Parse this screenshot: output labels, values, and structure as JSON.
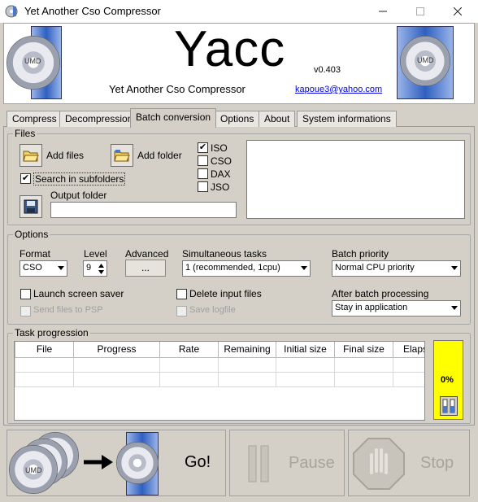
{
  "window": {
    "title": "Yet Another Cso Compressor"
  },
  "header": {
    "logo_text": "Yacc",
    "version": "v0.403",
    "subtitle": "Yet Another Cso Compressor",
    "email": "kapoue3@yahoo.com",
    "disc_label": "UMD"
  },
  "tabs": [
    {
      "label": "Compress"
    },
    {
      "label": "Decompression"
    },
    {
      "label": "Batch conversion",
      "active": true
    },
    {
      "label": "Options"
    },
    {
      "label": "About"
    },
    {
      "label": "System informations"
    }
  ],
  "files": {
    "group_label": "Files",
    "add_files_label": "Add files",
    "add_folder_label": "Add folder",
    "search_subfolders_label": "Search in subfolders",
    "search_subfolders_checked": true,
    "output_folder_label": "Output folder",
    "output_folder_value": "",
    "formats": [
      {
        "label": "ISO",
        "checked": true
      },
      {
        "label": "CSO",
        "checked": false
      },
      {
        "label": "DAX",
        "checked": false
      },
      {
        "label": "JSO",
        "checked": false
      }
    ]
  },
  "options": {
    "group_label": "Options",
    "format_label": "Format",
    "format_value": "CSO",
    "level_label": "Level",
    "level_value": "9",
    "advanced_label": "Advanced",
    "advanced_button": "...",
    "simultaneous_label": "Simultaneous tasks",
    "simultaneous_value": "1 (recommended, 1cpu)",
    "batch_priority_label": "Batch priority",
    "batch_priority_value": "Normal CPU priority",
    "launch_screensaver_label": "Launch screen saver",
    "delete_input_label": "Delete input files",
    "send_psp_label": "Send files to PSP",
    "save_logfile_label": "Save logfile",
    "after_batch_label": "After batch processing",
    "after_batch_value": "Stay in application"
  },
  "progress": {
    "group_label": "Task progression",
    "columns": [
      "File",
      "Progress",
      "Rate",
      "Remaining",
      "Initial size",
      "Final size",
      "Elaps"
    ],
    "percent_text": "0%",
    "percent_value": 0,
    "indicator_color": "#ffff00"
  },
  "actions": {
    "go_label": "Go!",
    "pause_label": "Pause",
    "stop_label": "Stop"
  }
}
